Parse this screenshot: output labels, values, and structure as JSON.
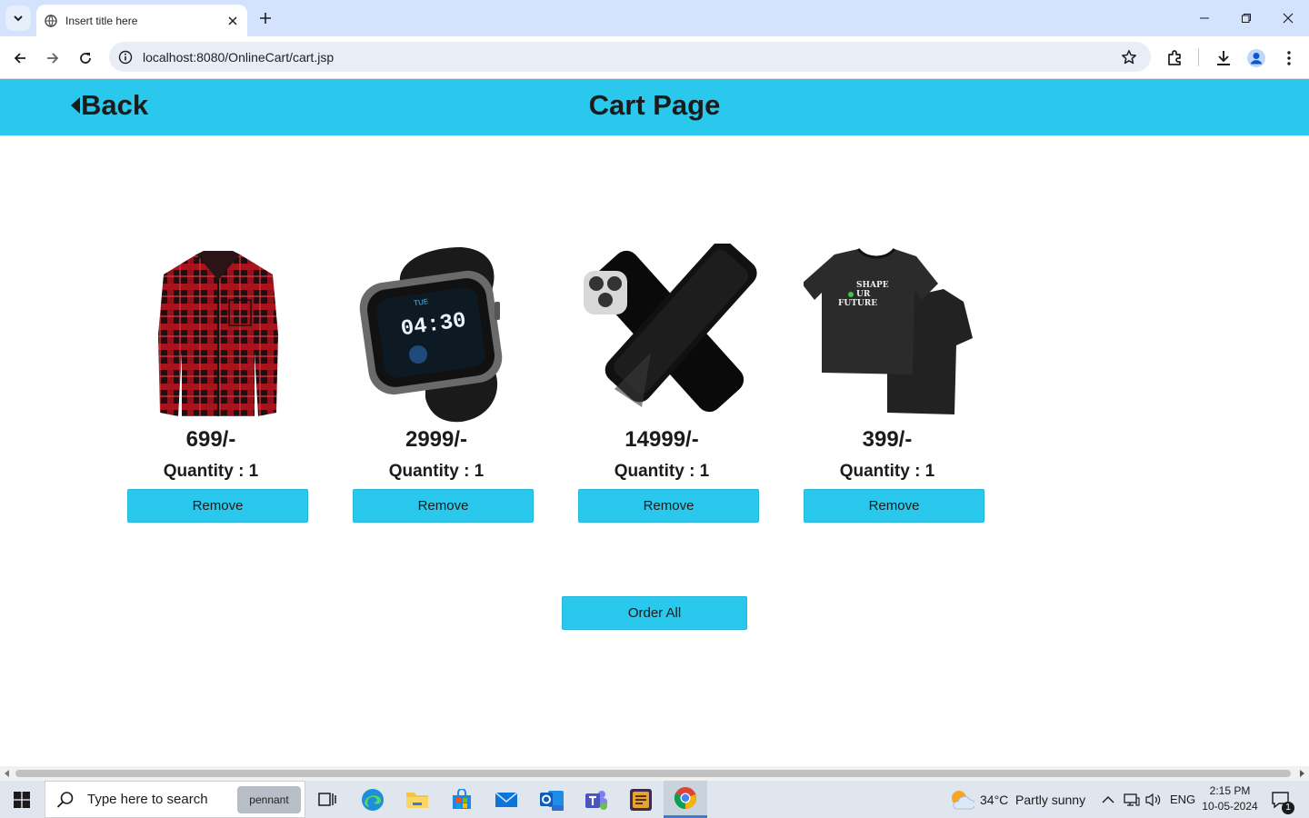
{
  "browser": {
    "tab_title": "Insert title here",
    "url": "localhost:8080/OnlineCart/cart.jsp"
  },
  "header": {
    "back_label": "Back",
    "title": "Cart Page"
  },
  "cart": {
    "items": [
      {
        "product": "shirt-icon",
        "price": "699/-",
        "quantity": "Quantity : 1",
        "remove_label": "Remove"
      },
      {
        "product": "smartwatch-icon",
        "price": "2999/-",
        "quantity": "Quantity : 1",
        "remove_label": "Remove",
        "watch_time": "04:30",
        "watch_day": "TUE"
      },
      {
        "product": "phone-case-icon",
        "price": "14999/-",
        "quantity": "Quantity : 1",
        "remove_label": "Remove"
      },
      {
        "product": "tshirt-icon",
        "price": "399/-",
        "quantity": "Quantity : 1",
        "remove_label": "Remove",
        "print_text": [
          "SHAPE",
          "UR",
          "FUTURE"
        ]
      }
    ],
    "order_all_label": "Order All"
  },
  "taskbar": {
    "search_placeholder": "Type here to search",
    "search_badge": "pennant",
    "weather": "34°C  Partly sunny",
    "language": "ENG",
    "time": "2:15 PM",
    "date": "10-05-2024",
    "notification_count": "1"
  },
  "colors": {
    "accent": "#29c8ec",
    "text": "#1b1b1b"
  }
}
